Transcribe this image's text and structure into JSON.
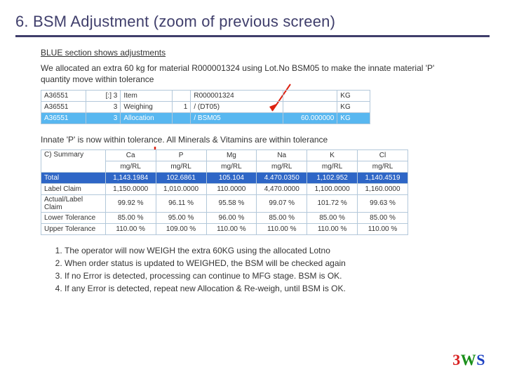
{
  "title": "6. BSM Adjustment (zoom of previous screen)",
  "blue_line": "BLUE section shows adjustments",
  "explain": "We allocated an extra 60 kg for material R000001324 using Lot.No BSM05 to make the innate material 'P' quantity move within tolerance",
  "tbl1": {
    "rows": [
      {
        "a": "A36551",
        "b": "[:] 3",
        "c": "Item",
        "d": "",
        "e": "R000001324",
        "f": "",
        "g": "KG"
      },
      {
        "a": "A36551",
        "b": "3",
        "c": "Weighing",
        "d": "1",
        "e": "/ (DT05)",
        "f": "",
        "g": "KG"
      },
      {
        "a": "A36551",
        "b": "3",
        "c": "Allocation",
        "d": "",
        "e": "/ BSM05",
        "f": "60.000000",
        "g": "KG"
      }
    ]
  },
  "tolerance_line": "Innate 'P' is now within tolerance.  All Minerals & Vitamins are within tolerance",
  "tbl2": {
    "row_hdr": "C) Summary",
    "cols": [
      {
        "name": "Ca",
        "unit": "mg/RL"
      },
      {
        "name": "P",
        "unit": "mg/RL"
      },
      {
        "name": "Mg",
        "unit": "mg/RL"
      },
      {
        "name": "Na",
        "unit": "mg/RL"
      },
      {
        "name": "K",
        "unit": "mg/RL"
      },
      {
        "name": "Cl",
        "unit": "mg/RL"
      }
    ],
    "rows": [
      {
        "label": "Total",
        "vals": [
          "1,143.1984",
          "102.6861",
          "105.104",
          "4.470.0350",
          "1,102.952",
          "1,140.4519"
        ],
        "total": true
      },
      {
        "label": "Label Claim",
        "vals": [
          "1,150.0000",
          "1,010.0000",
          "110.0000",
          "4,470.0000",
          "1,100.0000",
          "1,160.0000"
        ]
      },
      {
        "label": "Actual/Label Claim",
        "vals": [
          "99.92 %",
          "96.11 %",
          "95.58 %",
          "99.07 %",
          "101.72 %",
          "99.63 %"
        ]
      },
      {
        "label": "Lower Tolerance",
        "vals": [
          "85.00 %",
          "95.00 %",
          "96.00 %",
          "85.00 %",
          "85.00 %",
          "85.00 %"
        ]
      },
      {
        "label": "Upper Tolerance",
        "vals": [
          "110.00 %",
          "109.00 %",
          "110.00 %",
          "110.00 %",
          "110.00 %",
          "110.00 %"
        ]
      }
    ]
  },
  "steps": [
    "The operator will now WEIGH the extra 60KG using the allocated Lotno",
    "When order status is updated to WEIGHED, the BSM will be checked again",
    "If no Error is detected, processing can continue to MFG stage.  BSM is OK.",
    "If any Error is detected, repeat new Allocation & Re-weigh, until BSM is OK."
  ],
  "logo": {
    "l3": "3",
    "lW": "W",
    "lS": "S"
  }
}
